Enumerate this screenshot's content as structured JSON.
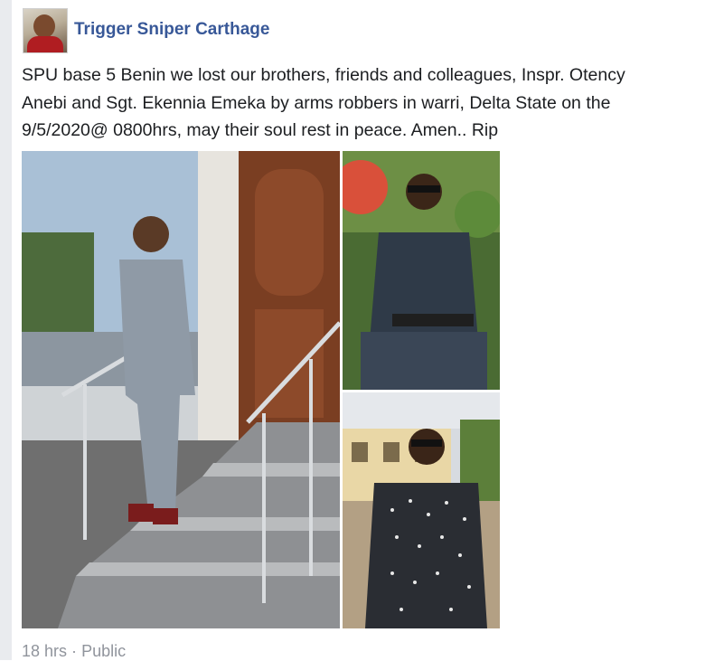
{
  "post": {
    "author": "Trigger Sniper Carthage",
    "text": "SPU base 5 Benin we lost our brothers, friends and colleagues, Inspr. Otency Anebi and Sgt. Ekennia Emeka by arms robbers in warri, Delta State on the 9/5/2020@ 0800hrs, may their soul rest in peace. Amen.. Rip",
    "timestamp": "18 hrs",
    "separator": "·",
    "audience": "Public",
    "audience_icon": "globe-icon",
    "avatar_icon": "profile-photo"
  },
  "colors": {
    "author_link": "#385898",
    "body_text": "#1c1e21",
    "meta_text": "#90949c",
    "left_rule": "#e9ebee"
  }
}
